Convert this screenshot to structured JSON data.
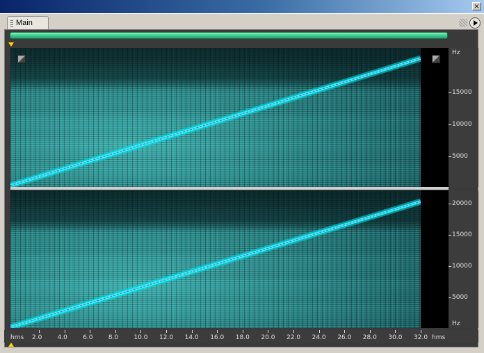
{
  "window": {
    "close_glyph": "×"
  },
  "panel": {
    "tab_label": "Main"
  },
  "overview": {
    "color": "#33c489"
  },
  "colors": {
    "sweep": "#00e8e8",
    "sweep_core": "#c040c0",
    "spectrogram": "#2a9c9c"
  },
  "channels": [
    {
      "name": "top",
      "unit_label": "Hz",
      "freq_labels": [
        "15000",
        "10000",
        "5000"
      ]
    },
    {
      "name": "bottom",
      "unit_label": "Hz",
      "freq_labels": [
        "20000",
        "15000",
        "10000",
        "5000"
      ]
    }
  ],
  "time_axis": {
    "unit_left": "hms",
    "unit_right": "hms",
    "labels": [
      "2.0",
      "4.0",
      "6.0",
      "8.0",
      "10.0",
      "12.0",
      "14.0",
      "16.0",
      "18.0",
      "20.0",
      "22.0",
      "24.0",
      "26.0",
      "28.0",
      "30.0",
      "32.0"
    ]
  }
}
